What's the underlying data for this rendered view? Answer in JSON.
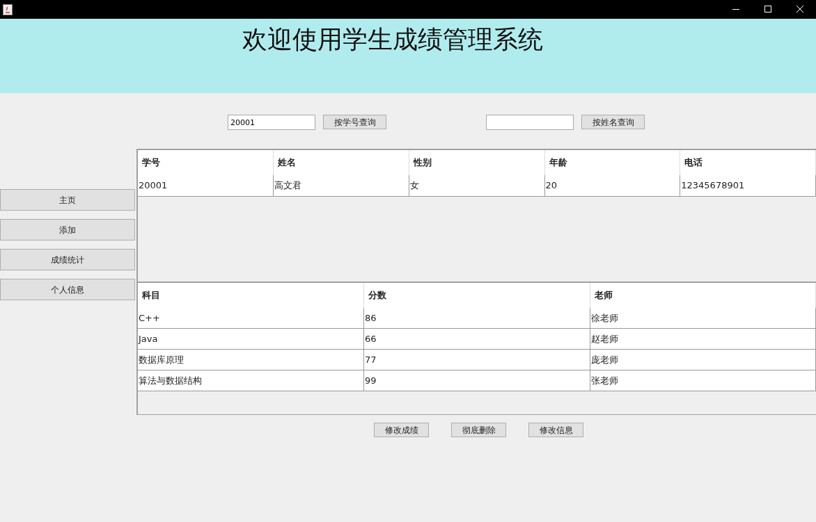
{
  "header": {
    "title": "欢迎使用学生成绩管理系统"
  },
  "search": [
    {
      "value": "20001",
      "button": "按学号查询"
    },
    {
      "button": "按姓名查询"
    }
  ],
  "sidebar": {
    "items": [
      "主页",
      "添加",
      "成绩统计",
      "个人信息"
    ]
  },
  "student_table": {
    "columns": [
      "学号",
      "姓名",
      "性别",
      "年龄",
      "电话"
    ],
    "rows": [
      [
        "20001",
        "高文君",
        "女",
        "20",
        "12345678901"
      ]
    ]
  },
  "score_table": {
    "columns": [
      "科目",
      "分数",
      "老师"
    ],
    "rows": [
      [
        "C++",
        "86",
        "徐老师"
      ],
      [
        "Java",
        "66",
        "赵老师"
      ],
      [
        "数据库原理",
        "77",
        "庞老师"
      ],
      [
        "算法与数据结构",
        "99",
        "张老师"
      ]
    ]
  },
  "actions": [
    "修改成绩",
    "彻底删除",
    "修改信息"
  ]
}
